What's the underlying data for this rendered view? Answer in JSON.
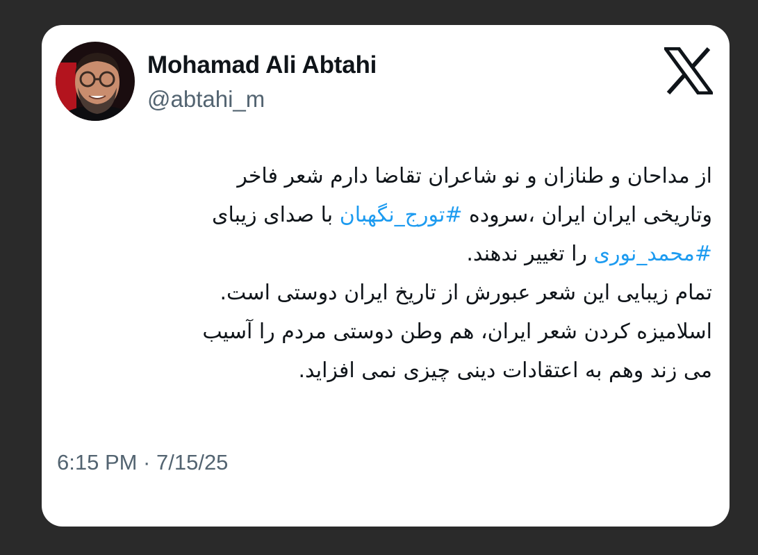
{
  "author": {
    "name": "Mohamad Ali Abtahi",
    "handle": "@abtahi_m",
    "avatar_icon": "profile-photo"
  },
  "brand_icon": "x-logo-icon",
  "tweet": {
    "line1": "از مداحان و طنازان و نو شاعران تقاضا دارم شعر فاخر",
    "line2_pre": "وتاریخی ایران ایران ،سروده ",
    "hashtag1": "#تورج_نگهبان",
    "line2_post": " با  صدای زیبای",
    "hashtag2": "#محمد_نوری",
    "line3_post": " را تغییر ندهند.",
    "line4": "تمام زیبایی این شعر عبورش از تاریخ ایران دوستی است.",
    "line5": "اسلامیزه کردن شعر ایران، هم وطن دوستی مردم را آسیب",
    "line6": "می زند وهم به اعتقادات دینی چیزی نمی افزاید."
  },
  "timestamp": "6:15 PM · 7/15/25",
  "colors": {
    "background": "#2a2a2a",
    "card": "#ffffff",
    "text": "#0f1419",
    "secondary": "#536471",
    "hashtag": "#1d9bf0"
  }
}
